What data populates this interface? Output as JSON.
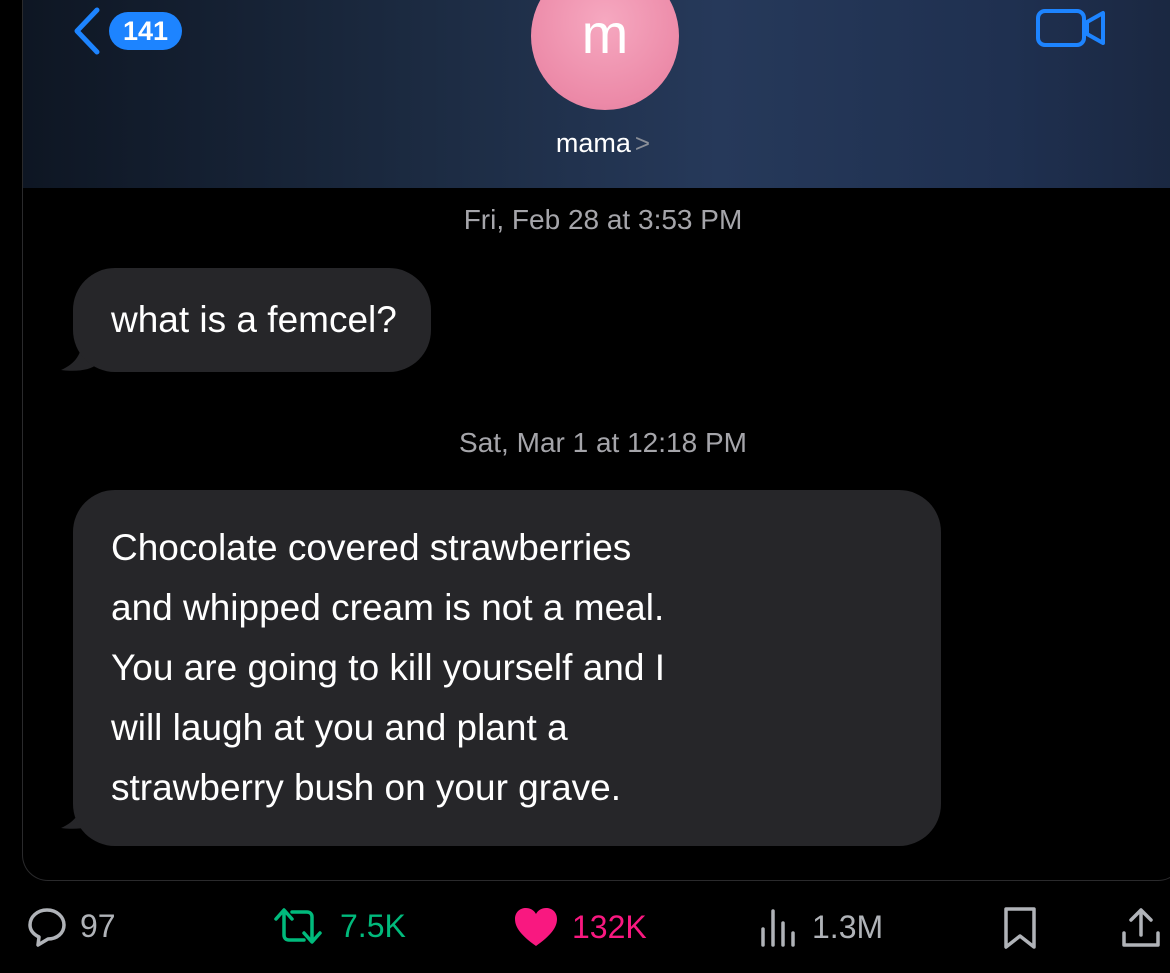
{
  "header": {
    "unread_count": "141",
    "avatar_initial": "m",
    "contact_name": "mama",
    "contact_chevron": ">"
  },
  "messages": [
    {
      "timestamp": "Fri, Feb 28 at 3:53 PM",
      "text": "what is a femcel?"
    },
    {
      "timestamp": "Sat, Mar 1 at 12:18 PM",
      "lines": [
        "Chocolate covered strawberries",
        "and whipped cream is not a meal.",
        "You are going to kill yourself and I",
        "will laugh at you and plant a",
        "strawberry bush on your grave."
      ]
    }
  ],
  "post_actions": {
    "replies": "97",
    "reposts": "7.5K",
    "likes": "132K",
    "views": "1.3M"
  },
  "colors": {
    "imessage_blue": "#1d84ff",
    "avatar_pink": "#ec8aa8",
    "bubble_gray": "#262629",
    "repost_green": "#00ba7c",
    "like_pink": "#f91880"
  },
  "icons": {
    "back": "chevron-left-icon",
    "video": "video-camera-icon",
    "reply": "speech-bubble-icon",
    "repost": "repost-arrows-icon",
    "like": "heart-icon",
    "views": "bar-chart-icon",
    "bookmark": "bookmark-icon",
    "share": "share-icon"
  }
}
